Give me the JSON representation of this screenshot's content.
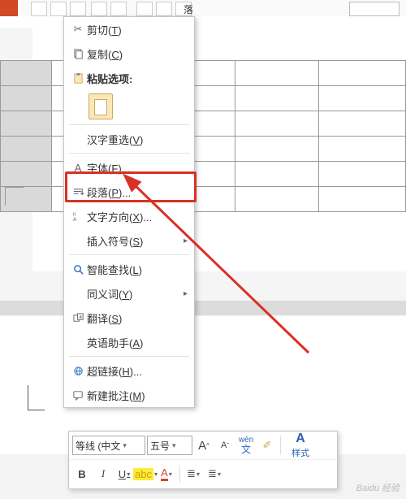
{
  "topbar": {
    "visible_text": "落"
  },
  "context_menu": {
    "cut": {
      "label": "剪切",
      "hotkey": "T"
    },
    "copy": {
      "label": "复制",
      "hotkey": "C"
    },
    "paste_header": "粘贴选项:",
    "hanzi": {
      "label": "汉字重选",
      "hotkey": "V"
    },
    "font": {
      "label": "字体",
      "hotkey": "F",
      "suffix": "..."
    },
    "para": {
      "label": "段落",
      "hotkey": "P",
      "suffix": "..."
    },
    "dir": {
      "label": "文字方向",
      "hotkey": "X",
      "suffix": "..."
    },
    "sym": {
      "label": "插入符号",
      "hotkey": "S"
    },
    "smart": {
      "label": "智能查找",
      "hotkey": "L"
    },
    "syn": {
      "label": "同义词",
      "hotkey": "Y"
    },
    "trans": {
      "label": "翻译",
      "hotkey": "S"
    },
    "eng": {
      "label": "英语助手",
      "hotkey": "A"
    },
    "link": {
      "label": "超链接",
      "hotkey": "H",
      "suffix": "..."
    },
    "comm": {
      "label": "新建批注",
      "hotkey": "M"
    }
  },
  "mini_toolbar": {
    "font_name": "等线 (中文",
    "font_size": "五号",
    "increase": "A",
    "decrease": "A",
    "phonetic": "wén",
    "format_painter": "✐",
    "styles_label": "样式",
    "bold": "B",
    "italic": "I",
    "underline": "U",
    "strike": "abc",
    "highlight": "ab",
    "fontcolor": "A",
    "bullets": "≣",
    "numbering": "≣"
  },
  "watermark": "Baidu 经验"
}
